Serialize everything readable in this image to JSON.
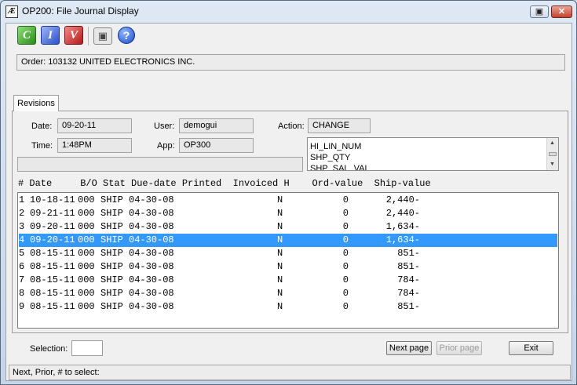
{
  "window": {
    "title": "OP200: File Journal Display",
    "icon_glyph": "Æ",
    "restore_glyph": "▣",
    "close_glyph": "✕"
  },
  "toolbar": {
    "c_label": "C",
    "i_label": "I",
    "v_label": "V",
    "snapshot_glyph": "▣",
    "help_label": "?"
  },
  "order": {
    "text": "Order: 103132  UNITED ELECTRONICS INC."
  },
  "tabs": [
    {
      "label": "Revisions"
    }
  ],
  "details": {
    "date_label": "Date:",
    "date_value": "09-20-11",
    "user_label": "User:",
    "user_value": "demogui",
    "action_label": "Action:",
    "action_value": "CHANGE",
    "time_label": "Time:",
    "time_value": "1:48PM",
    "app_label": "App:",
    "app_value": "OP300"
  },
  "changed_fields": [
    "HI_LIN_NUM",
    "SHP_QTY",
    "SHP_SAL_VAL"
  ],
  "scroll_arrows": {
    "up": "▲",
    "down": "▼"
  },
  "table": {
    "columns": [
      "#",
      "Date",
      "B/O",
      "Stat",
      "Due-date",
      "Printed",
      "Invoiced",
      "H",
      "Ord-value",
      "Ship-value"
    ],
    "header_line": "# Date     B/O Stat Due-date Printed  Invoiced H    Ord-value  Ship-value",
    "selected_index": 3,
    "rows": [
      {
        "num": "1",
        "date": "10-18-11",
        "bo": "000",
        "stat": "SHIP",
        "due": "04-30-08",
        "printed": "",
        "invoiced": "",
        "h": "N",
        "ord": "0",
        "ship": "2,440-"
      },
      {
        "num": "2",
        "date": "09-21-11",
        "bo": "000",
        "stat": "SHIP",
        "due": "04-30-08",
        "printed": "",
        "invoiced": "",
        "h": "N",
        "ord": "0",
        "ship": "2,440-"
      },
      {
        "num": "3",
        "date": "09-20-11",
        "bo": "000",
        "stat": "SHIP",
        "due": "04-30-08",
        "printed": "",
        "invoiced": "",
        "h": "N",
        "ord": "0",
        "ship": "1,634-"
      },
      {
        "num": "4",
        "date": "09-20-11",
        "bo": "000",
        "stat": "SHIP",
        "due": "04-30-08",
        "printed": "",
        "invoiced": "",
        "h": "N",
        "ord": "0",
        "ship": "1,634-"
      },
      {
        "num": "5",
        "date": "08-15-11",
        "bo": "000",
        "stat": "SHIP",
        "due": "04-30-08",
        "printed": "",
        "invoiced": "",
        "h": "N",
        "ord": "0",
        "ship": "851-"
      },
      {
        "num": "6",
        "date": "08-15-11",
        "bo": "000",
        "stat": "SHIP",
        "due": "04-30-08",
        "printed": "",
        "invoiced": "",
        "h": "N",
        "ord": "0",
        "ship": "851-"
      },
      {
        "num": "7",
        "date": "08-15-11",
        "bo": "000",
        "stat": "SHIP",
        "due": "04-30-08",
        "printed": "",
        "invoiced": "",
        "h": "N",
        "ord": "0",
        "ship": "784-"
      },
      {
        "num": "8",
        "date": "08-15-11",
        "bo": "000",
        "stat": "SHIP",
        "due": "04-30-08",
        "printed": "",
        "invoiced": "",
        "h": "N",
        "ord": "0",
        "ship": "784-"
      },
      {
        "num": "9",
        "date": "08-15-11",
        "bo": "000",
        "stat": "SHIP",
        "due": "04-30-08",
        "printed": "",
        "invoiced": "",
        "h": "N",
        "ord": "0",
        "ship": "851-"
      }
    ]
  },
  "footer": {
    "selection_label": "Selection:",
    "selection_value": "",
    "next_label": "Next page",
    "prior_label": "Prior page",
    "exit_label": "Exit"
  },
  "status": {
    "text": "Next, Prior, # to select:"
  },
  "colors": {
    "selection": "#3399ff",
    "close_button": "#c4412b"
  },
  "icons": [
    "app-logo-icon",
    "restore-icon",
    "close-icon",
    "c-icon",
    "i-icon",
    "v-icon",
    "camera-icon",
    "help-icon",
    "scroll-up-icon",
    "scroll-down-icon"
  ]
}
